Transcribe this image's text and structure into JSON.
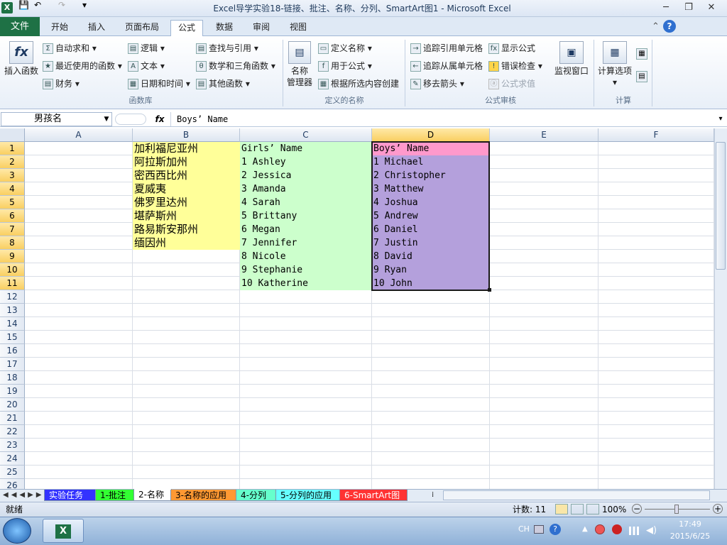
{
  "window": {
    "title": "Excel导学实验18-链接、批注、名称、分列、SmartArt图1 - Microsoft Excel",
    "minimize": "─",
    "restore": "❐",
    "close": "✕"
  },
  "quick_access": {
    "app_icon": "X",
    "save": "💾",
    "undo": "↶",
    "redo": "↷",
    "customize": "▾"
  },
  "ribbon_tabs": [
    "文件",
    "开始",
    "插入",
    "页面布局",
    "公式",
    "数据",
    "审阅",
    "视图"
  ],
  "active_tab": "公式",
  "ribbon": {
    "insert_function": "插入函数",
    "fx_symbol": "fx",
    "autosum": "自动求和",
    "recent": "最近使用的函数",
    "financial": "财务",
    "logical": "逻辑",
    "text": "文本",
    "datetime": "日期和时间",
    "lookup": "查找与引用",
    "math": "数学和三角函数",
    "more": "其他函数",
    "group_library": "函数库",
    "name_manager_1": "名称",
    "name_manager_2": "管理器",
    "define_name": "定义名称",
    "use_in_formula": "用于公式",
    "create_from_sel": "根据所选内容创建",
    "group_names": "定义的名称",
    "trace_precedents": "追踪引用单元格",
    "trace_dependents": "追踪从属单元格",
    "remove_arrows": "移去箭头",
    "show_formulas": "显示公式",
    "error_checking": "错误检查",
    "evaluate": "公式求值",
    "watch_window": "监视窗口",
    "group_audit": "公式审核",
    "calc_options": "计算选项",
    "group_calc": "计算"
  },
  "formula_bar": {
    "name_box": "男孩名",
    "fx": "fx",
    "content": "Boys’ Name"
  },
  "columns": [
    "A",
    "B",
    "C",
    "D",
    "E",
    "F"
  ],
  "selected_column": "D",
  "rows": [
    "1",
    "2",
    "3",
    "4",
    "5",
    "6",
    "7",
    "8",
    "9",
    "10",
    "11",
    "12",
    "13",
    "14",
    "15",
    "16",
    "17",
    "18",
    "19",
    "20",
    "21",
    "22",
    "23",
    "24",
    "25",
    "26"
  ],
  "cells": {
    "B": [
      "加利福尼亚州",
      "阿拉斯加州",
      "密西西比州",
      "夏威夷",
      "佛罗里达州",
      "堪萨斯州",
      "路易斯安那州",
      "缅因州"
    ],
    "C": [
      "Girls’ Name",
      "1 Ashley",
      "2 Jessica",
      "3 Amanda",
      "4 Sarah",
      "5 Brittany",
      "6 Megan",
      "7 Jennifer",
      "8 Nicole",
      "9 Stephanie",
      "10 Katherine"
    ],
    "D": [
      "Boys’ Name",
      "1 Michael",
      "2 Christopher",
      "3 Matthew",
      "4 Joshua",
      "5 Andrew",
      "6 Daniel",
      "7 Justin",
      "8 David",
      "9 Ryan",
      "10 John"
    ]
  },
  "colors": {
    "b_fill": "#ffff99",
    "c_fill": "#ccffcc",
    "d_fill": "#b4a0dc",
    "d1_fill": "#ff99cc"
  },
  "sheet_tabs": [
    {
      "label": "实验任务",
      "color": "#3333ff"
    },
    {
      "label": "1-批注",
      "color": "#33ff33"
    },
    {
      "label": "2-名称",
      "color": "#ffffff"
    },
    {
      "label": "3-名称的应用",
      "color": "#ff9933"
    },
    {
      "label": "4-分列",
      "color": "#66ffcc"
    },
    {
      "label": "5-分列的应用",
      "color": "#66ffff"
    },
    {
      "label": "6-SmartArt图",
      "color": "#ff3333"
    }
  ],
  "active_sheet": "2-名称",
  "status": {
    "ready": "就绪",
    "count": "计数: 11",
    "zoom": "100%"
  },
  "taskbar": {
    "lang": "CH",
    "time": "17:49",
    "date": "2015/6/25"
  }
}
